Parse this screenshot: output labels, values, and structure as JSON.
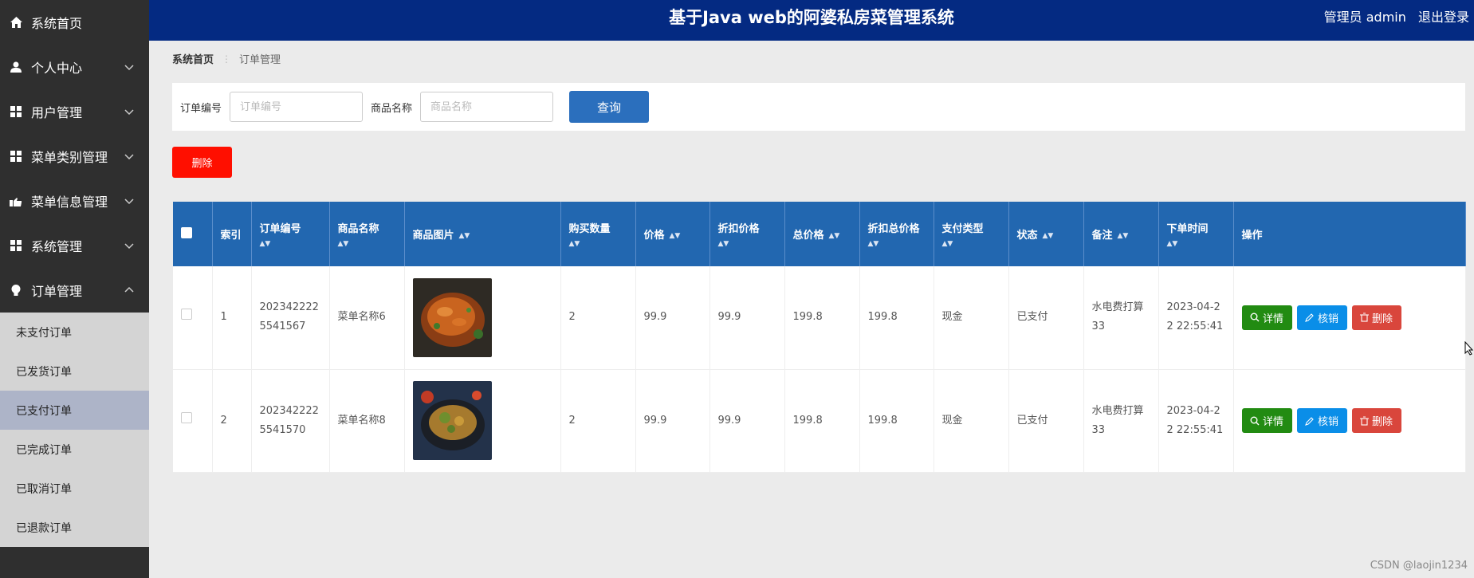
{
  "header": {
    "title": "基于Java web的阿婆私房菜管理系统",
    "user_label": "管理员 admin",
    "logout_label": "退出登录"
  },
  "sidebar": {
    "items": [
      {
        "label": "系统首页",
        "icon": "home-icon"
      },
      {
        "label": "个人中心",
        "icon": "user-icon"
      },
      {
        "label": "用户管理",
        "icon": "grid-icon"
      },
      {
        "label": "菜单类别管理",
        "icon": "grid-icon"
      },
      {
        "label": "菜单信息管理",
        "icon": "hand-icon"
      },
      {
        "label": "系统管理",
        "icon": "grid-icon"
      },
      {
        "label": "订单管理",
        "icon": "bulb-icon"
      }
    ],
    "sub_items": [
      "未支付订单",
      "已发货订单",
      "已支付订单",
      "已完成订单",
      "已取消订单",
      "已退款订单"
    ],
    "active_sub": "已支付订单"
  },
  "breadcrumb": {
    "home": "系统首页",
    "current": "订单管理"
  },
  "search": {
    "order_no_label": "订单编号",
    "order_no_placeholder": "订单编号",
    "product_label": "商品名称",
    "product_placeholder": "商品名称",
    "query_label": "查询"
  },
  "delete_label": "删除",
  "table": {
    "headers": [
      "索引",
      "订单编号",
      "商品名称",
      "商品图片",
      "购买数量",
      "价格",
      "折扣价格",
      "总价格",
      "折扣总价格",
      "支付类型",
      "状态",
      "备注",
      "下单时间",
      "操作"
    ],
    "rows": [
      {
        "index": "1",
        "order_no": "2023422225541567",
        "name": "菜单名称6",
        "qty": "2",
        "price": "99.9",
        "discount_price": "99.9",
        "total": "199.8",
        "discount_total": "199.8",
        "pay_type": "现金",
        "status": "已支付",
        "remark": "水电费打算33",
        "time": "2023-04-22 22:55:41"
      },
      {
        "index": "2",
        "order_no": "2023422225541570",
        "name": "菜单名称8",
        "qty": "2",
        "price": "99.9",
        "discount_price": "99.9",
        "total": "199.8",
        "discount_total": "199.8",
        "pay_type": "现金",
        "status": "已支付",
        "remark": "水电费打算33",
        "time": "2023-04-22 22:55:41"
      }
    ],
    "actions": {
      "detail": "详情",
      "verify": "核销",
      "delete": "删除"
    }
  },
  "watermark": "CSDN @laojin1234",
  "colors": {
    "header": "#042a82",
    "sidebar": "#2f2f2f",
    "table_header": "#2267b0",
    "detail": "#228b12",
    "verify": "#0a8ee8",
    "delete": "#d9463c"
  }
}
